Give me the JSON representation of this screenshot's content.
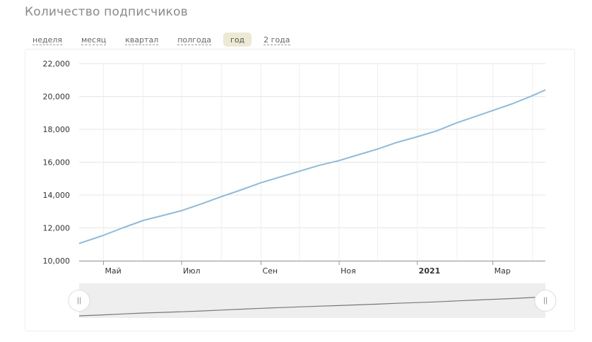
{
  "header": {
    "title": "Количество подписчиков"
  },
  "tabs": [
    {
      "label": "неделя",
      "active": false
    },
    {
      "label": "месяц",
      "active": false
    },
    {
      "label": "квартал",
      "active": false
    },
    {
      "label": "полгода",
      "active": false
    },
    {
      "label": "год",
      "active": true
    },
    {
      "label": "2 года",
      "active": false
    }
  ],
  "colors": {
    "line": "#8fbad8",
    "grid": "#e6e6e6",
    "navigator_bg": "#eeeeee",
    "navigator_line": "#777777",
    "active_tab": "#ece9d4"
  },
  "navigator": {
    "handle_left_icon": "grip-handle-icon",
    "handle_right_icon": "grip-handle-icon"
  },
  "chart_data": {
    "type": "line",
    "title": "Количество подписчиков",
    "xlabel": "",
    "ylabel": "",
    "ylim": [
      10000,
      22000
    ],
    "yticks": [
      10000,
      12000,
      14000,
      16000,
      18000,
      20000,
      22000
    ],
    "ytick_labels": [
      "10,000",
      "12,000",
      "14,000",
      "16,000",
      "18,000",
      "20,000",
      "22,000"
    ],
    "xlim": [
      "2020-04-12",
      "2021-04-11"
    ],
    "xticks": [
      {
        "label": "Май",
        "date": "2020-05-01",
        "bold": false
      },
      {
        "label": "Июл",
        "date": "2020-07-01",
        "bold": false
      },
      {
        "label": "Сен",
        "date": "2020-09-01",
        "bold": false
      },
      {
        "label": "Ноя",
        "date": "2020-11-01",
        "bold": false
      },
      {
        "label": "2021",
        "date": "2021-01-01",
        "bold": true
      },
      {
        "label": "Мар",
        "date": "2021-03-01",
        "bold": false
      }
    ],
    "grid_dates": [
      "2020-05-01",
      "2020-06-01",
      "2020-07-01",
      "2020-08-01",
      "2020-09-01",
      "2020-10-01",
      "2020-11-01",
      "2020-12-01",
      "2021-01-01",
      "2021-02-01",
      "2021-03-01",
      "2021-04-01"
    ],
    "grid": true,
    "series": [
      {
        "name": "",
        "x": [
          "2020-04-12",
          "2020-05-01",
          "2020-05-16",
          "2020-06-01",
          "2020-06-16",
          "2020-07-01",
          "2020-07-16",
          "2020-08-01",
          "2020-08-16",
          "2020-09-01",
          "2020-09-16",
          "2020-10-01",
          "2020-10-16",
          "2020-11-01",
          "2020-11-16",
          "2020-12-01",
          "2020-12-16",
          "2021-01-01",
          "2021-01-16",
          "2021-02-01",
          "2021-02-16",
          "2021-03-01",
          "2021-03-16",
          "2021-04-01",
          "2021-04-11"
        ],
        "y": [
          11050,
          11550,
          12000,
          12450,
          12750,
          13050,
          13450,
          13900,
          14300,
          14750,
          15100,
          15450,
          15800,
          16100,
          16450,
          16800,
          17200,
          17550,
          17900,
          18400,
          18800,
          19150,
          19550,
          20050,
          20400
        ]
      }
    ]
  }
}
